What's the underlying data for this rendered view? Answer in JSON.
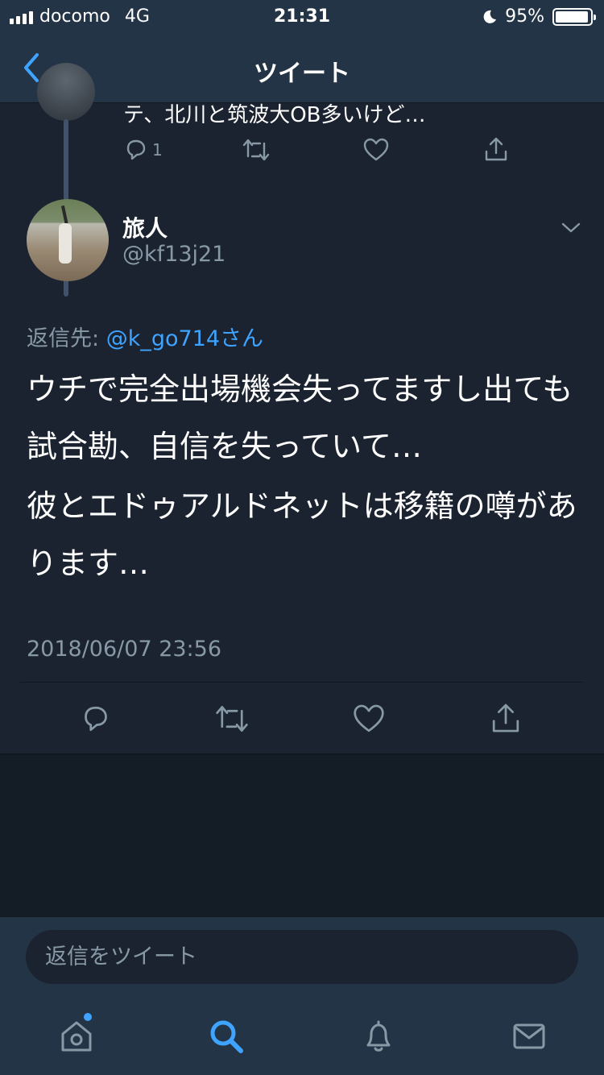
{
  "status_bar": {
    "carrier": "docomo",
    "network": "4G",
    "time": "21:31",
    "battery_percent": "95%",
    "battery_level": 0.95
  },
  "nav": {
    "title": "ツイート"
  },
  "previous_tweet": {
    "text_partial": "テ、北川と筑波大OB多いけど…",
    "reply_count": "1"
  },
  "tweet": {
    "author_name": "旅人",
    "author_handle": "@kf13j21",
    "reply_to_prefix": "返信先: ",
    "reply_to_user": "@k_go714さん",
    "paragraphs": [
      "ウチで完全出場機会失ってますし出ても試合勘、自信を失っていて…",
      "彼とエドゥアルドネットは移籍の噂があります…"
    ],
    "timestamp": "2018/06/07 23:56"
  },
  "reply_bar": {
    "placeholder": "返信をツイート"
  },
  "colors": {
    "background": "#1b2330",
    "bar": "#243447",
    "accent": "#3ea4ff",
    "muted": "#8899a6"
  },
  "tab_bar": {
    "tabs": [
      "home-icon",
      "search-icon",
      "notifications-icon",
      "messages-icon"
    ],
    "active": "search-icon"
  }
}
